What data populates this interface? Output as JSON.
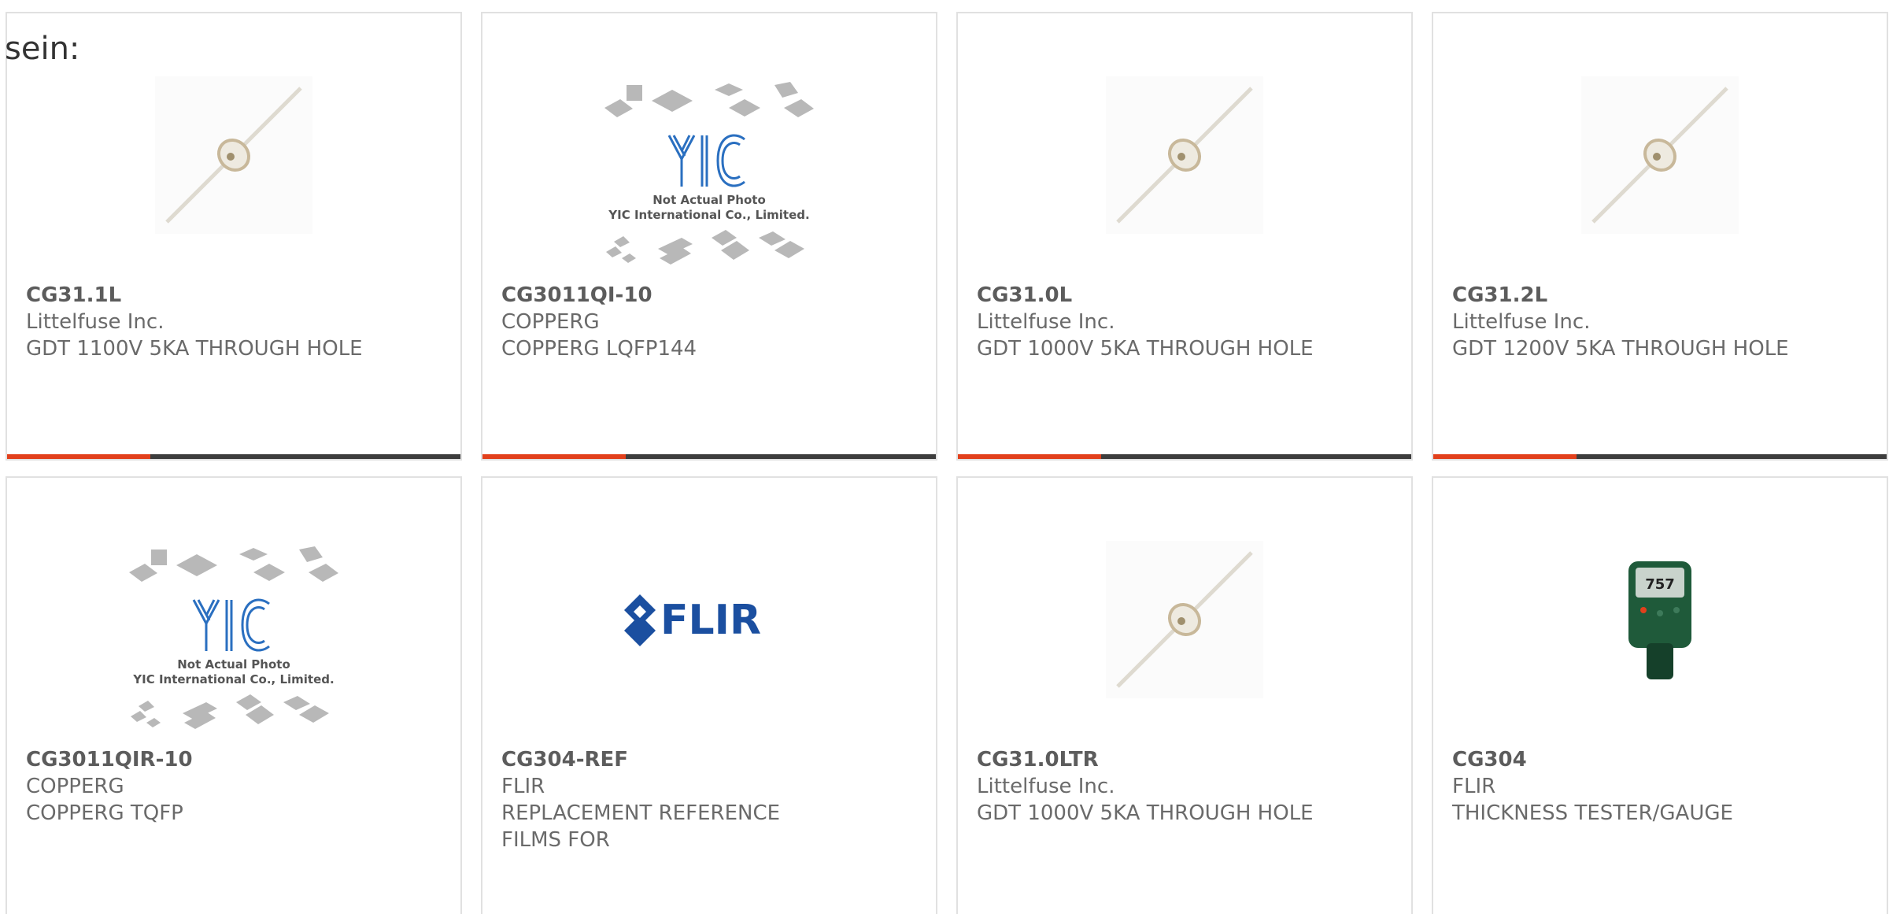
{
  "intro_text": "sein:",
  "products": [
    {
      "part": "CG31.1L",
      "manufacturer": "Littelfuse Inc.",
      "description": [
        "GDT 1100V 5KA THROUGH HOLE"
      ],
      "image": "gdt-component",
      "accent_bar": true
    },
    {
      "part": "CG3011QI-10",
      "manufacturer": "COPPERG",
      "description": [
        "COPPERG LQFP144"
      ],
      "image": "yic-placeholder",
      "accent_bar": true
    },
    {
      "part": "CG31.0L",
      "manufacturer": "Littelfuse Inc.",
      "description": [
        "GDT 1000V 5KA THROUGH HOLE"
      ],
      "image": "gdt-component",
      "accent_bar": true
    },
    {
      "part": "CG31.2L",
      "manufacturer": "Littelfuse Inc.",
      "description": [
        "GDT 1200V 5KA THROUGH HOLE"
      ],
      "image": "gdt-component",
      "accent_bar": true
    },
    {
      "part": "CG3011QIR-10",
      "manufacturer": "COPPERG",
      "description": [
        "COPPERG TQFP"
      ],
      "image": "yic-placeholder",
      "accent_bar": false
    },
    {
      "part": "CG304-REF",
      "manufacturer": "FLIR",
      "description": [
        "REPLACEMENT REFERENCE",
        "FILMS FOR"
      ],
      "image": "flir-logo",
      "accent_bar": false
    },
    {
      "part": "CG31.0LTR",
      "manufacturer": "Littelfuse Inc.",
      "description": [
        "GDT 1000V 5KA THROUGH HOLE"
      ],
      "image": "gdt-component",
      "accent_bar": false
    },
    {
      "part": "CG304",
      "manufacturer": "FLIR",
      "description": [
        "THICKNESS TESTER/GAUGE"
      ],
      "image": "thickness-gauge",
      "accent_bar": false
    }
  ],
  "yic_image_text": {
    "line1": "Not Actual Photo",
    "line2": "YIC International Co., Limited.",
    "logo": "YIC"
  },
  "flir_logo_text": "FLIR",
  "gauge_readout": "757",
  "colors": {
    "accent": "#e2401c",
    "bar": "#3d3d3d",
    "border": "#e1e1e1",
    "text": "#6a6a6a",
    "yic_blue": "#2a6fc0",
    "flir_blue": "#1b4fa0",
    "gauge_green": "#1f5a3a"
  }
}
